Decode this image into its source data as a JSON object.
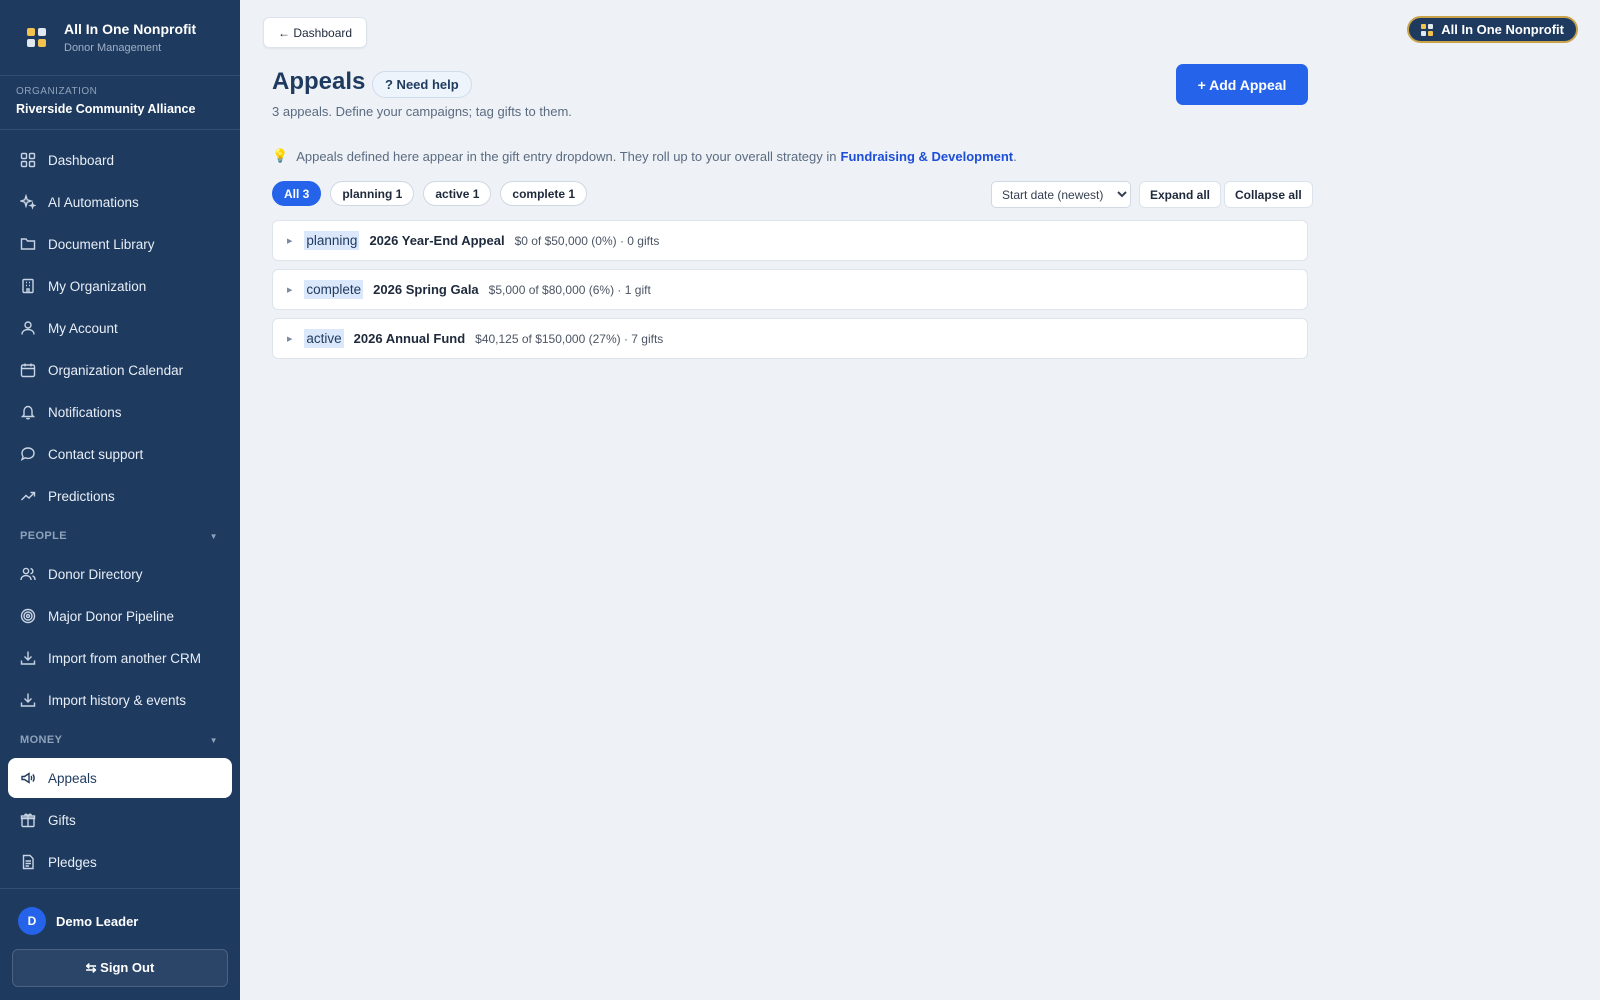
{
  "brand": {
    "title": "All In One Nonprofit",
    "subtitle": "Donor Management",
    "logo_colors": [
      "#f2c14e",
      "#e2e8f0",
      "#e2e8f0",
      "#f2c14e"
    ]
  },
  "organization": {
    "label": "ORGANIZATION",
    "name": "Riverside Community Alliance"
  },
  "nav": {
    "items": [
      {
        "label": "Dashboard",
        "icon": "grid-icon"
      },
      {
        "label": "AI Automations",
        "icon": "sparkles-icon"
      },
      {
        "label": "Document Library",
        "icon": "folder-icon"
      },
      {
        "label": "My Organization",
        "icon": "building-icon"
      },
      {
        "label": "My Account",
        "icon": "user-icon"
      },
      {
        "label": "Organization Calendar",
        "icon": "calendar-icon"
      },
      {
        "label": "Notifications",
        "icon": "bell-icon"
      },
      {
        "label": "Contact support",
        "icon": "chat-icon"
      },
      {
        "label": "Predictions",
        "icon": "trending-up-icon"
      }
    ],
    "people_section": {
      "title": "PEOPLE",
      "items": [
        {
          "label": "Donor Directory",
          "icon": "users-icon"
        },
        {
          "label": "Major Donor Pipeline",
          "icon": "target-icon"
        },
        {
          "label": "Import from another CRM",
          "icon": "download-icon"
        },
        {
          "label": "Import history & events",
          "icon": "download-icon"
        }
      ]
    },
    "money_section": {
      "title": "MONEY",
      "items": [
        {
          "label": "Appeals",
          "icon": "megaphone-icon",
          "active": true
        },
        {
          "label": "Gifts",
          "icon": "gift-icon"
        },
        {
          "label": "Pledges",
          "icon": "document-icon"
        }
      ]
    }
  },
  "user": {
    "initial": "D",
    "name": "Demo Leader",
    "sign_out": "⇆ Sign Out"
  },
  "header": {
    "back_label": "← Dashboard",
    "top_badge": "All In One Nonprofit",
    "title": "Appeals",
    "help_label": "? Need help",
    "subtitle": "3 appeals. Define your campaigns; tag gifts to them.",
    "add_label": "+ Add Appeal"
  },
  "tip": {
    "icon": "lightbulb-icon",
    "text": "Appeals defined here appear in the gift entry dropdown. They roll up to your overall strategy in",
    "link": "Fundraising & Development",
    "suffix": "."
  },
  "filters": {
    "chips": [
      {
        "label": "All 3",
        "active": true
      },
      {
        "label": "planning 1",
        "active": false
      },
      {
        "label": "active 1",
        "active": false
      },
      {
        "label": "complete 1",
        "active": false
      }
    ],
    "sort_selected": "Start date (newest)",
    "expand_label": "Expand all",
    "collapse_label": "Collapse all"
  },
  "appeals": [
    {
      "status": "planning",
      "name": "2026 Year-End Appeal",
      "meta": "$0 of $50,000 (0%) · 0 gifts"
    },
    {
      "status": "complete",
      "name": "2026 Spring Gala",
      "meta": "$5,000 of $80,000 (6%) · 1 gift"
    },
    {
      "status": "active",
      "name": "2026 Annual Fund",
      "meta": "$40,125 of $150,000 (27%) · 7 gifts"
    }
  ],
  "colors": {
    "sidebar_bg": "#1e3a5f",
    "accent": "#2563eb",
    "page_bg": "#eef2f7",
    "badge_border": "#c9a34a"
  }
}
